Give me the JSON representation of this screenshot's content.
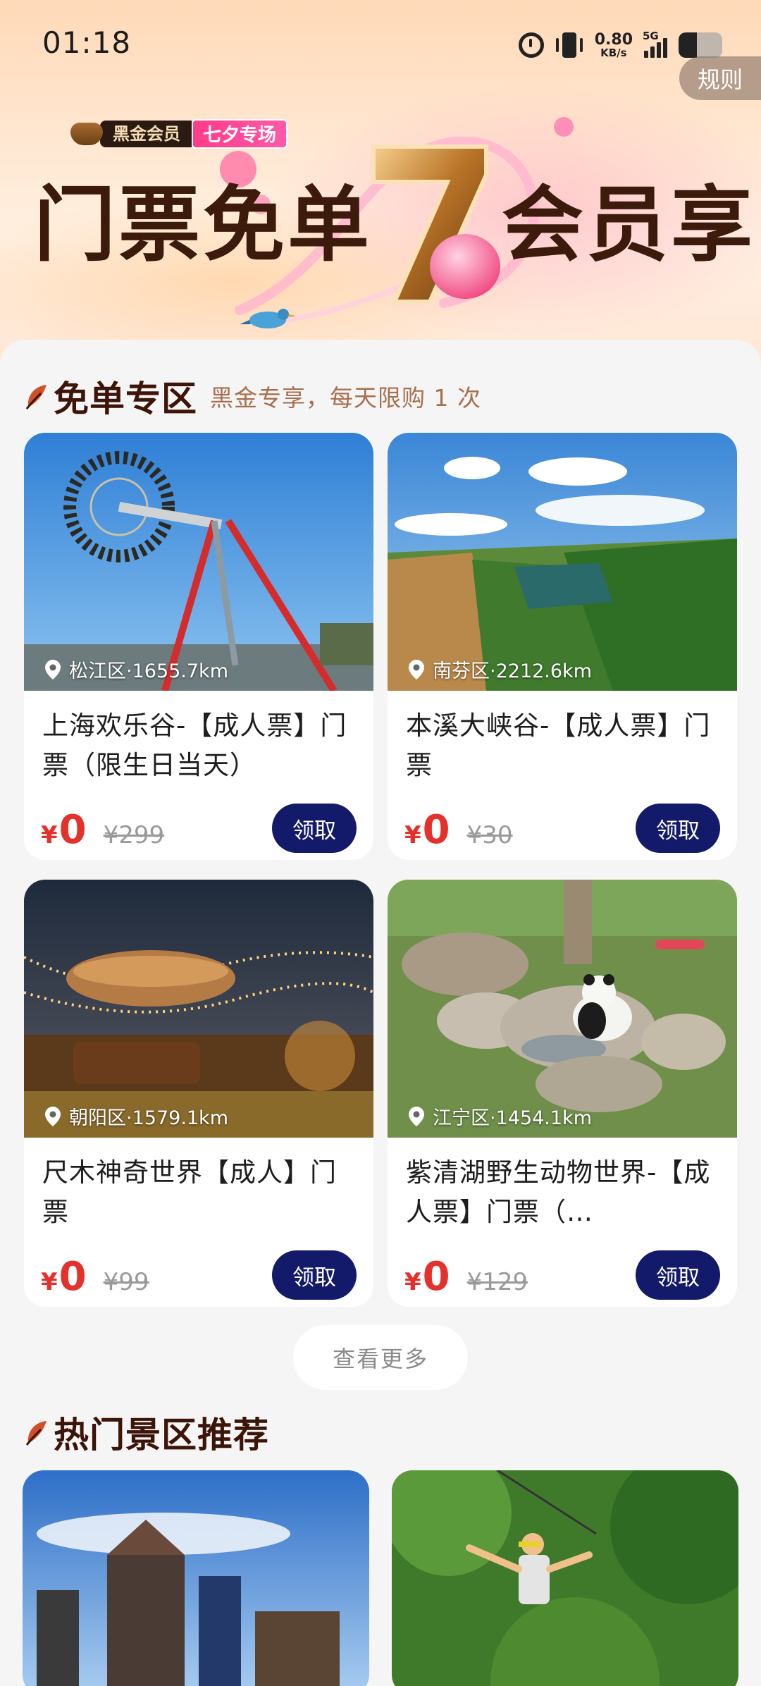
{
  "status_bar": {
    "time": "01:18",
    "speed_value": "0.80",
    "speed_unit": "KB/s",
    "network": "5G"
  },
  "header": {
    "rules_label": "规则",
    "member_label": "黑金会员",
    "event_label": "七夕专场",
    "headline_left": "门票免单",
    "headline_right": "会员享"
  },
  "free_section": {
    "title": "免单专区",
    "subtitle": "黑金专享，每天限购 1 次",
    "more_label": "查看更多",
    "items": [
      {
        "location": "松江区·1655.7km",
        "name": "上海欢乐谷-【成人票】门票（限生日当天）",
        "currency": "¥",
        "price": "0",
        "original_price": "¥299",
        "claim_label": "领取"
      },
      {
        "location": "南芬区·2212.6km",
        "name": "本溪大峡谷-【成人票】门票",
        "currency": "¥",
        "price": "0",
        "original_price": "¥30",
        "claim_label": "领取"
      },
      {
        "location": "朝阳区·1579.1km",
        "name": "尺木神奇世界【成人】门票",
        "currency": "¥",
        "price": "0",
        "original_price": "¥99",
        "claim_label": "领取"
      },
      {
        "location": "江宁区·1454.1km",
        "name": "紫清湖野生动物世界-【成人票】门票（…",
        "currency": "¥",
        "price": "0",
        "original_price": "¥129",
        "claim_label": "领取"
      }
    ]
  },
  "hot_section": {
    "title": "热门景区推荐"
  },
  "colors": {
    "accent_red": "#e5312b",
    "claim_button": "#131a6a",
    "section_title": "#3c1408",
    "event_pink": "#ff3c8a"
  },
  "icons": [
    "alarm-icon",
    "vibrate-icon",
    "signal-icon",
    "battery-icon",
    "location-pin-icon",
    "leaf-icon"
  ]
}
